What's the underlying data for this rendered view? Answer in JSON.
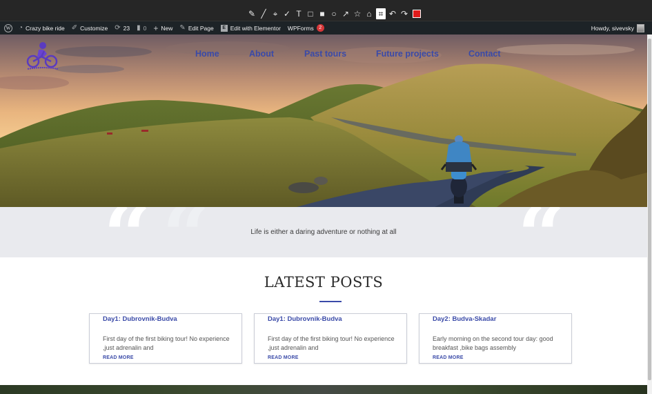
{
  "toolbar": {
    "tools": [
      {
        "icon": "pen-icon",
        "glyph": "✎"
      },
      {
        "icon": "line-icon",
        "glyph": "╱"
      },
      {
        "icon": "marker-icon",
        "glyph": "⌖"
      },
      {
        "icon": "check-icon",
        "glyph": "✓"
      },
      {
        "icon": "text-icon",
        "glyph": "T"
      },
      {
        "icon": "rectangle-outline-icon",
        "glyph": "□"
      },
      {
        "icon": "rectangle-filled-icon",
        "glyph": "■"
      },
      {
        "icon": "circle-icon",
        "glyph": "○"
      },
      {
        "icon": "arrow-icon",
        "glyph": "↗"
      },
      {
        "icon": "star-icon",
        "glyph": "☆"
      },
      {
        "icon": "home-icon",
        "glyph": "⌂"
      },
      {
        "icon": "crop-icon",
        "glyph": "⌗"
      },
      {
        "icon": "undo-icon",
        "glyph": "↶"
      },
      {
        "icon": "redo-icon",
        "glyph": "↷"
      }
    ],
    "active_tool": "crop-icon",
    "color": "#e01b1b"
  },
  "admin_bar": {
    "site_name": "Crazy bike ride",
    "customize": "Customize",
    "updates": "23",
    "comments": "0",
    "new": "New",
    "edit_page": "Edit Page",
    "edit_elementor": "Edit with Elementor",
    "wpforms": "WPForms",
    "wpforms_badge": "2",
    "howdy": "Howdy, sivevsky"
  },
  "nav": {
    "items": [
      "Home",
      "About",
      "Past tours",
      "Future projects",
      "Contact"
    ]
  },
  "quote": {
    "text": "Life is either a daring adventure or nothing at all"
  },
  "posts": {
    "title": "LATEST POSTS",
    "read_more": "READ MORE",
    "items": [
      {
        "title": "Day1: Dubrovnik-Budva",
        "excerpt": "First day of the first biking tour! No experience ,just adrenalin and"
      },
      {
        "title": "Day1: Dubrovnik-Budva",
        "excerpt": "First day of the first biking tour! No experience ,just adrenalin and"
      },
      {
        "title": "Day2: Budva-Skadar",
        "excerpt": "Early morning on the second tour day: good breakfast ,bike bags assembly"
      }
    ]
  },
  "colors": {
    "accent": "#3a4aa8",
    "admin_bar": "#1d2327",
    "quote_band": "#e9eaee"
  }
}
